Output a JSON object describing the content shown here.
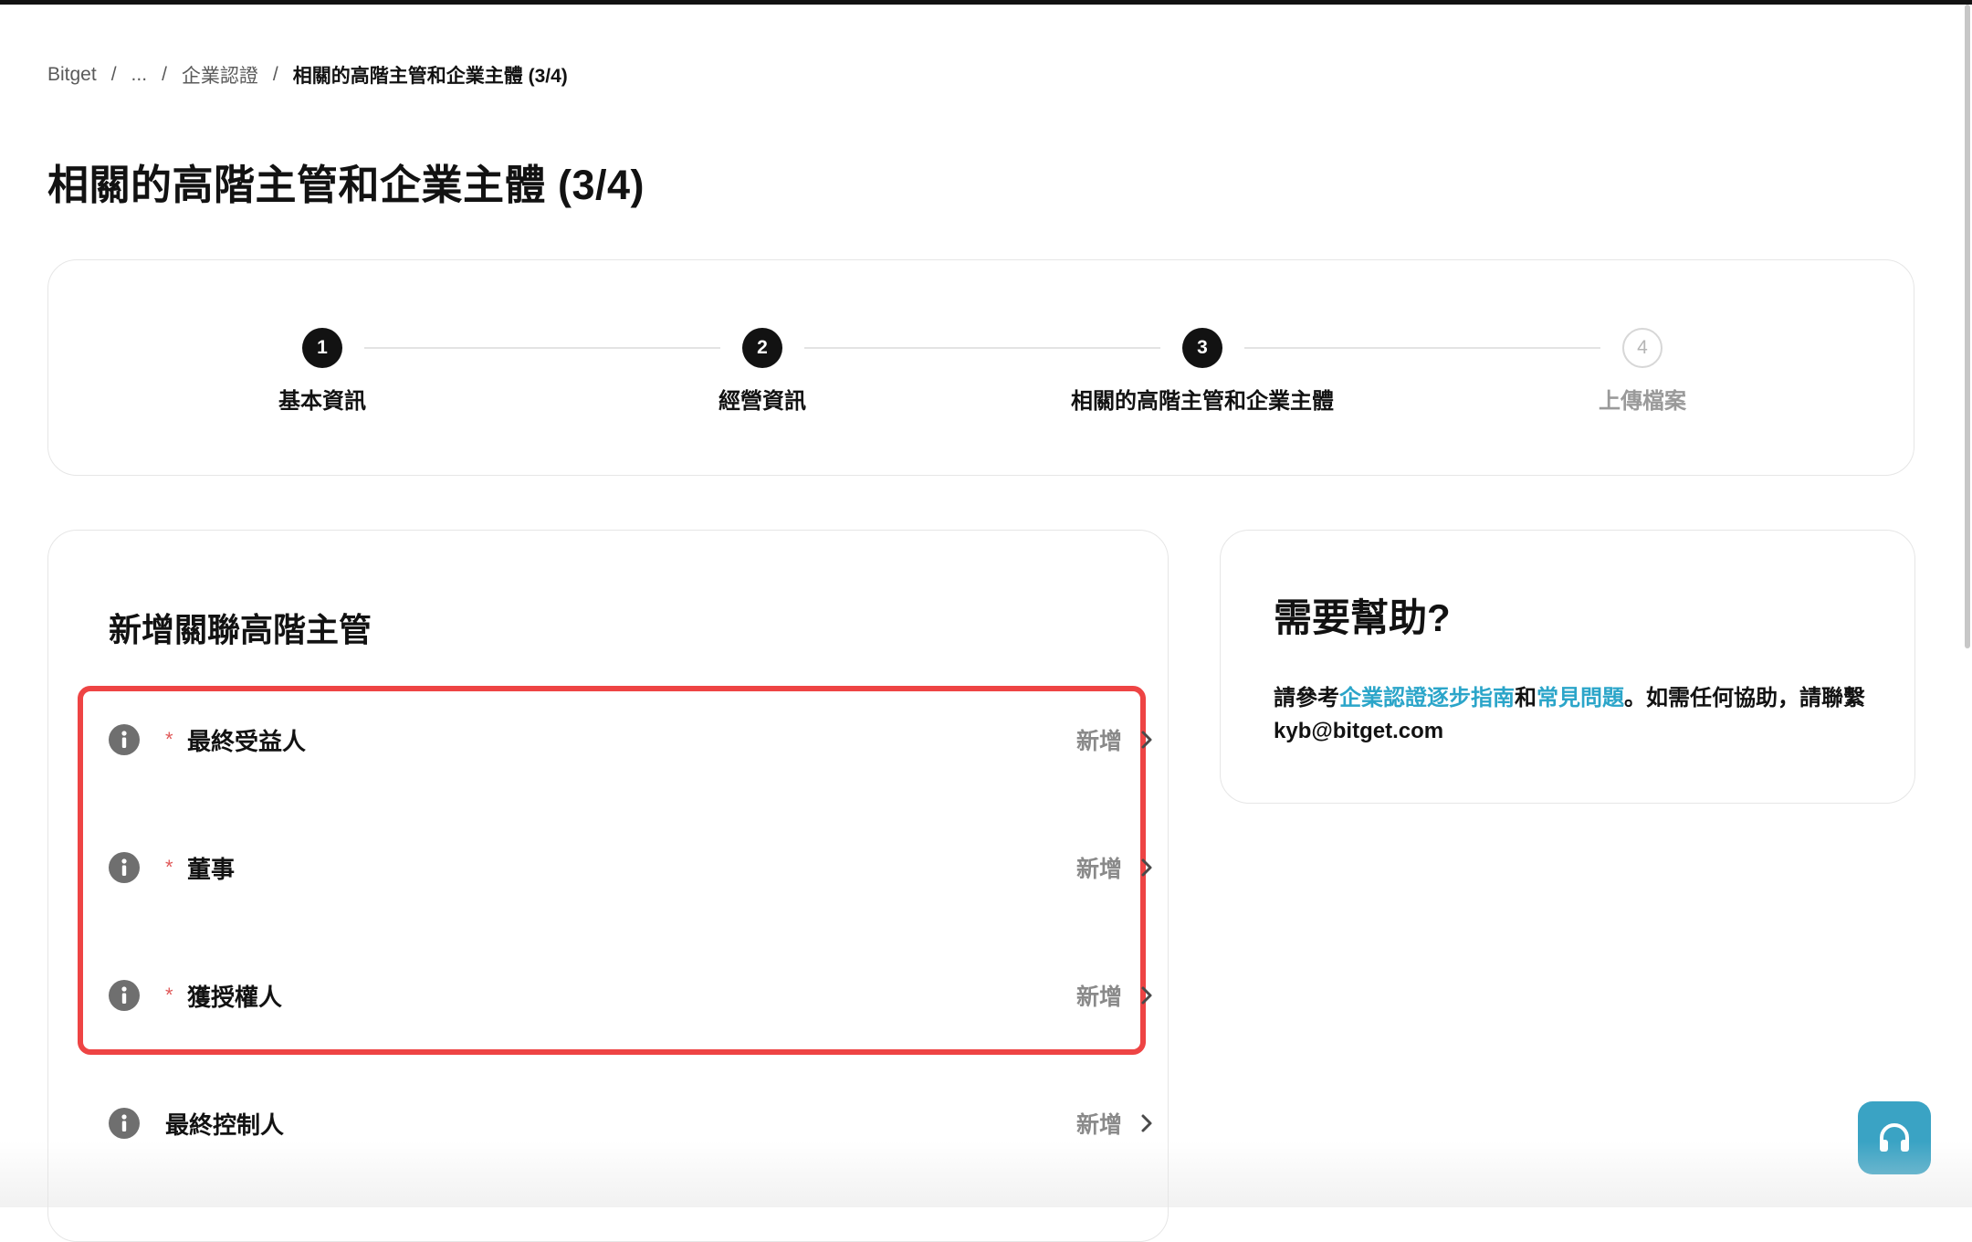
{
  "breadcrumb": {
    "items": [
      "Bitget",
      "...",
      "企業認證"
    ],
    "separator": "/",
    "current": "相關的高階主管和企業主體 (3/4)"
  },
  "page": {
    "title": "相關的高階主管和企業主體 (3/4)"
  },
  "stepper": {
    "steps": [
      {
        "number": "1",
        "label": "基本資訊",
        "status": "completed"
      },
      {
        "number": "2",
        "label": "經營資訊",
        "status": "completed"
      },
      {
        "number": "3",
        "label": "相關的高階主管和企業主體",
        "status": "current"
      },
      {
        "number": "4",
        "label": "上傳檔案",
        "status": "pending"
      }
    ]
  },
  "executives": {
    "title": "新增關聯高階主管",
    "required_mark": "*",
    "rows": [
      {
        "label": "最終受益人",
        "required": true,
        "action": "新增"
      },
      {
        "label": "董事",
        "required": true,
        "action": "新增"
      },
      {
        "label": "獲授權人",
        "required": true,
        "action": "新增"
      },
      {
        "label": "最終控制人",
        "required": false,
        "action": "新增"
      }
    ]
  },
  "help": {
    "title": "需要幫助?",
    "text_prefix": "請參考",
    "link_guide": "企業認證逐步指南",
    "text_and": "和",
    "link_faq": "常見問題",
    "text_suffix": "。如需任何協助，請聯繫 kyb@bitget.com"
  },
  "support_button": {
    "icon": "headset-icon"
  },
  "colors": {
    "accent_link": "#2ba5c9",
    "highlight_border": "#ee4444",
    "support_button": "#3aa3c4",
    "step_done": "#121212"
  }
}
